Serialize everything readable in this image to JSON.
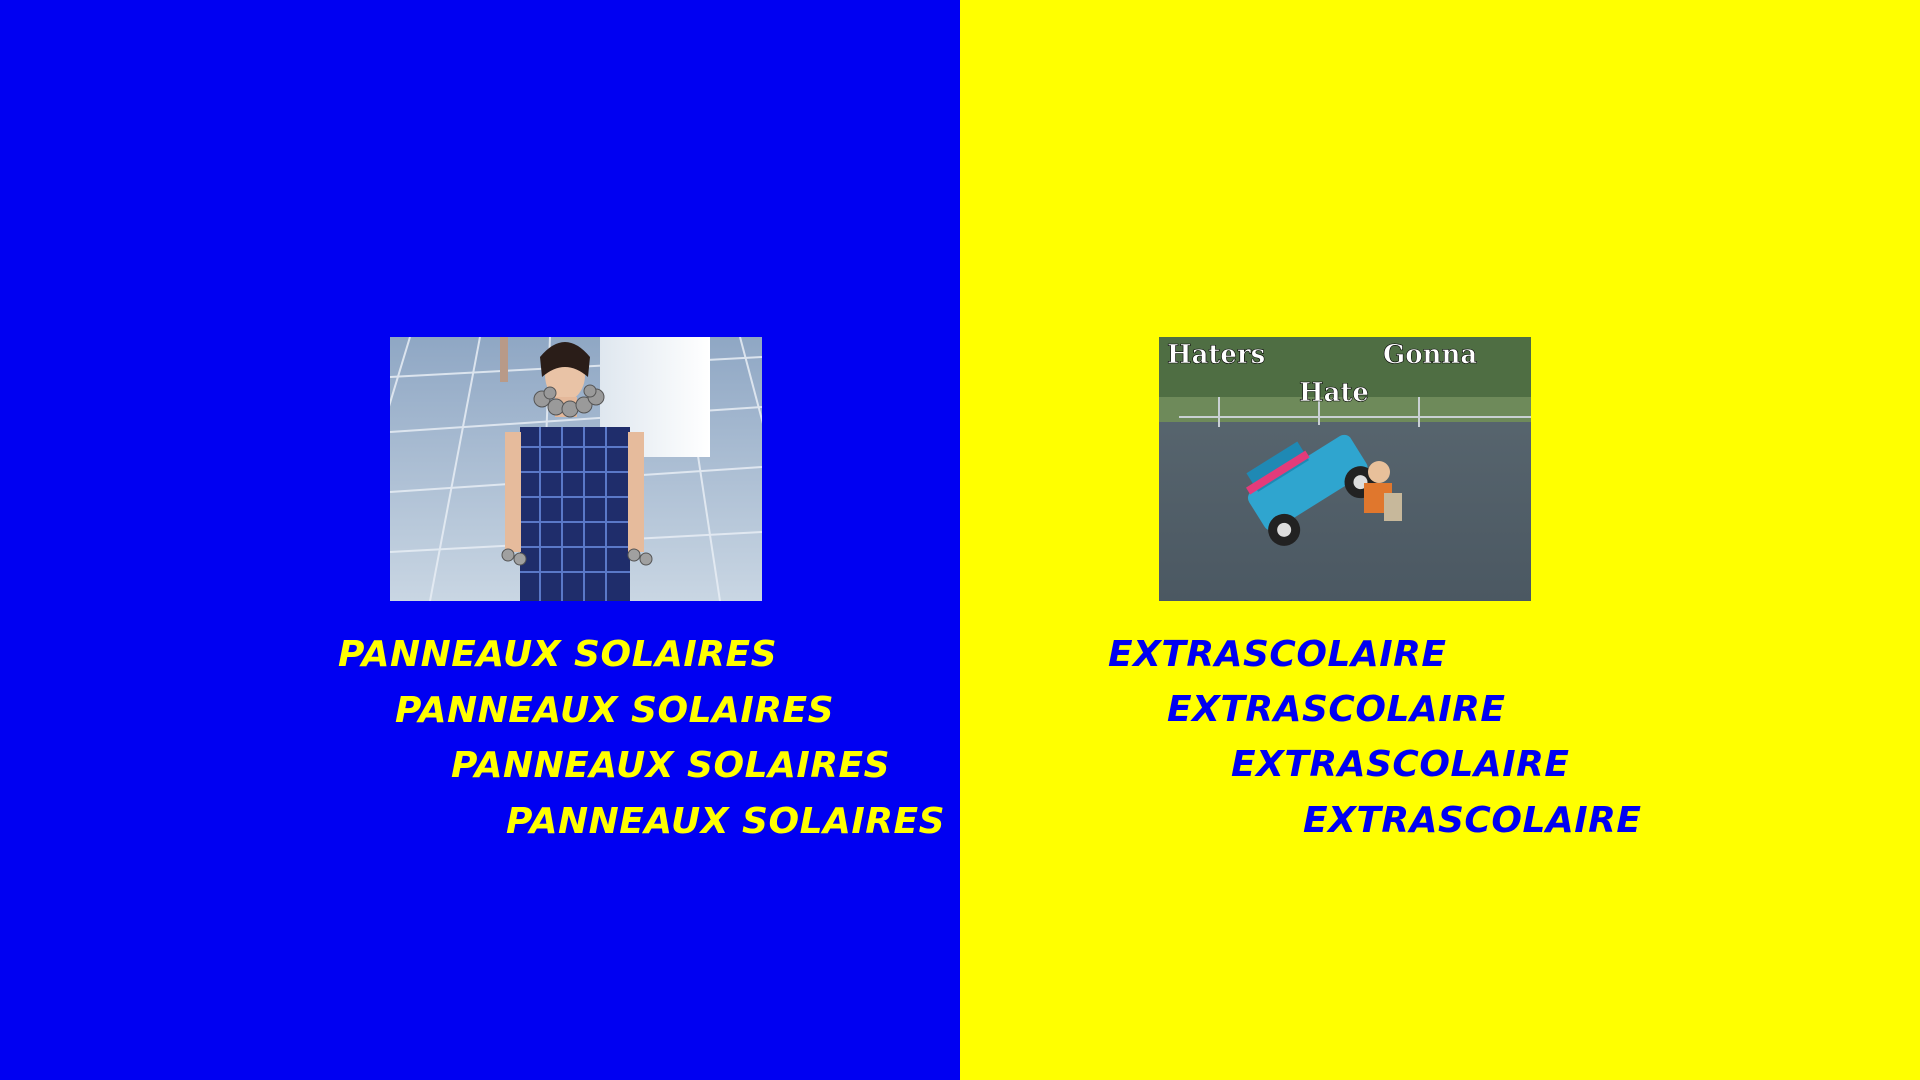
{
  "colors": {
    "left_background": "#0000f2",
    "right_background": "#ffff00",
    "left_text": "#ffff00",
    "right_text": "#0000f2"
  },
  "left_panel": {
    "image_description_icon": "runway-model-solar-panel-dress-photo",
    "lines": [
      "PANNEAUX SOLAIRES",
      "PANNEAUX SOLAIRES",
      "PANNEAUX SOLAIRES",
      "PANNEAUX SOLAIRES"
    ]
  },
  "right_panel": {
    "image_description_icon": "kid-toy-jeep-meme-photo",
    "image_caption_top_left": "Haters",
    "image_caption_top_right": "Gonna",
    "image_caption_bottom": "Hate",
    "lines": [
      "EXTRASCOLAIRE",
      "EXTRASCOLAIRE",
      "EXTRASCOLAIRE",
      "EXTRASCOLAIRE"
    ]
  }
}
